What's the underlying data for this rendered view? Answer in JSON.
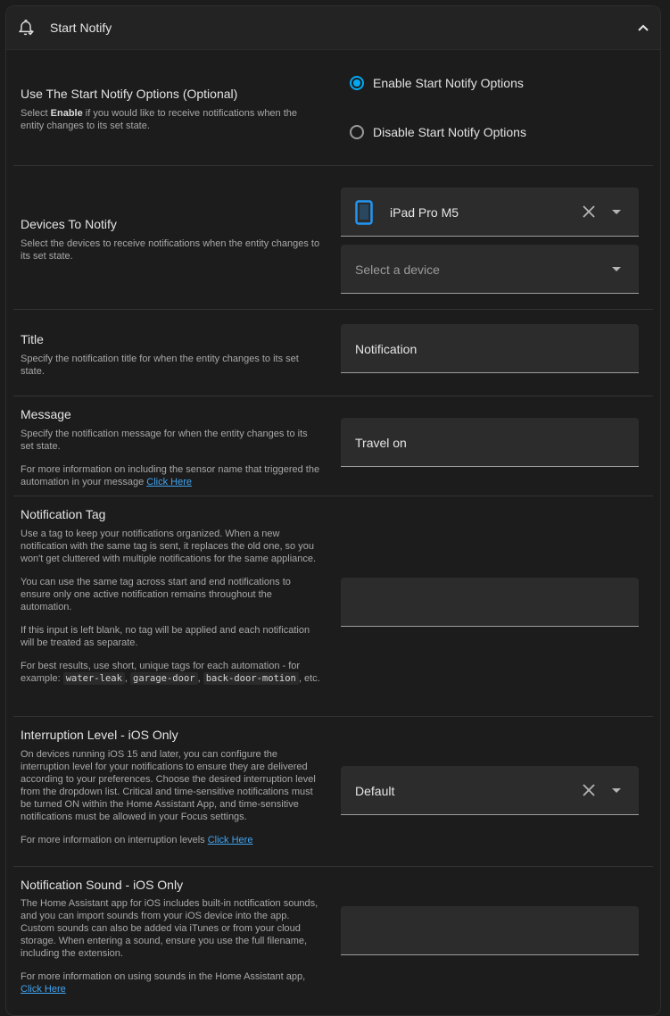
{
  "header": {
    "title": "Start Notify",
    "bell_icon": "bell-check-icon",
    "collapse_icon": "chevron-up-icon"
  },
  "accent_color": "#03a9f4",
  "link_color": "#41a4f0",
  "sections": {
    "use": {
      "title": "Use The Start Notify Options (Optional)",
      "desc_pre": "Select ",
      "desc_bold": "Enable",
      "desc_post": " if you would like to receive notifications when the entity changes to its set state.",
      "options": [
        {
          "label": "Enable Start Notify Options",
          "selected": true
        },
        {
          "label": "Disable Start Notify Options",
          "selected": false
        }
      ]
    },
    "devices": {
      "title": "Devices To Notify",
      "desc": "Select the devices to receive notifications when the entity changes to its set state.",
      "selected_device": "iPad Pro M5",
      "device_icon": "tablet-icon",
      "add_placeholder": "Select a device"
    },
    "title": {
      "title": "Title",
      "desc": "Specify the notification title for when the entity changes to its set state.",
      "value": "Notification"
    },
    "message": {
      "title": "Message",
      "desc1": "Specify the notification message for when the entity changes to its set state.",
      "desc2_pre": "For more information on including the sensor name that triggered the automation in your message ",
      "link": "Click Here",
      "value": "Travel on"
    },
    "tag": {
      "title": "Notification Tag",
      "p1": "Use a tag to keep your notifications organized. When a new notification with the same tag is sent, it replaces the old one, so you won't get cluttered with multiple notifications for the same appliance.",
      "p2": "You can use the same tag across start and end notifications to ensure only one active notification remains throughout the automation.",
      "p3": "If this input is left blank, no tag will be applied and each notification will be treated as separate.",
      "p4_pre": "For best results, use short, unique tags for each automation - for example: ",
      "code1": "water-leak",
      "sep1": ", ",
      "code2": "garage-door",
      "sep2": ", ",
      "code3": "back-door-motion",
      "p4_post": ", etc.",
      "value": ""
    },
    "interruption": {
      "title": "Interruption Level - iOS Only",
      "p1": "On devices running iOS 15 and later, you can configure the interruption level for your notifications to ensure they are delivered according to your preferences. Choose the desired interruption level from the dropdown list. Critical and time-sensitive notifications must be turned ON within the Home Assistant App, and time-sensitive notifications must be allowed in your Focus settings.",
      "p2_pre": "For more information on interruption levels ",
      "link": "Click Here",
      "value": "Default"
    },
    "sound": {
      "title": "Notification Sound - iOS Only",
      "p1": "The Home Assistant app for iOS includes built-in notification sounds, and you can import sounds from your iOS device into the app. Custom sounds can also be added via iTunes or from your cloud storage. When entering a sound, ensure you use the full filename, including the extension.",
      "p2_pre": "For more information on using sounds in the Home Assistant app, ",
      "link": "Click Here",
      "value": ""
    }
  }
}
